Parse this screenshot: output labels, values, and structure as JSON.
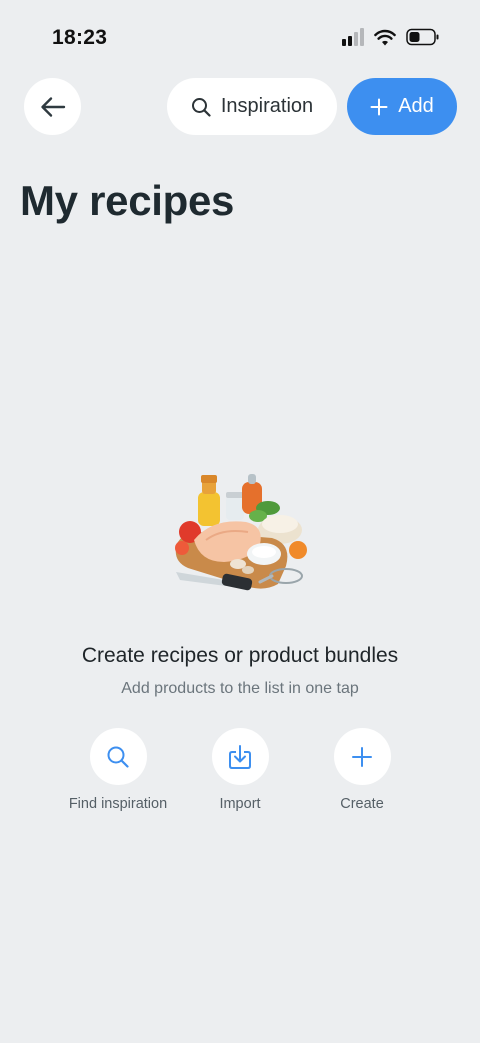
{
  "status_bar": {
    "time": "18:23",
    "icons": [
      "signal-icon",
      "wifi-icon",
      "battery-icon"
    ]
  },
  "header": {
    "back_icon": "arrow-left-icon",
    "inspiration_label": "Inspiration",
    "add_label": "Add"
  },
  "page": {
    "title": "My recipes"
  },
  "empty_state": {
    "illustration": "food-ingredients-illustration",
    "title": "Create recipes or product bundles",
    "subtitle": "Add products to the list in one tap"
  },
  "actions": [
    {
      "label": "Find inspiration",
      "icon": "search-icon"
    },
    {
      "label": "Import",
      "icon": "import-icon"
    },
    {
      "label": "Create",
      "icon": "plus-icon"
    }
  ],
  "colors": {
    "background": "#eceef0",
    "accent": "#3d8ff0",
    "surface": "#ffffff",
    "text_primary": "#1f2529",
    "text_secondary": "#6b757c"
  }
}
